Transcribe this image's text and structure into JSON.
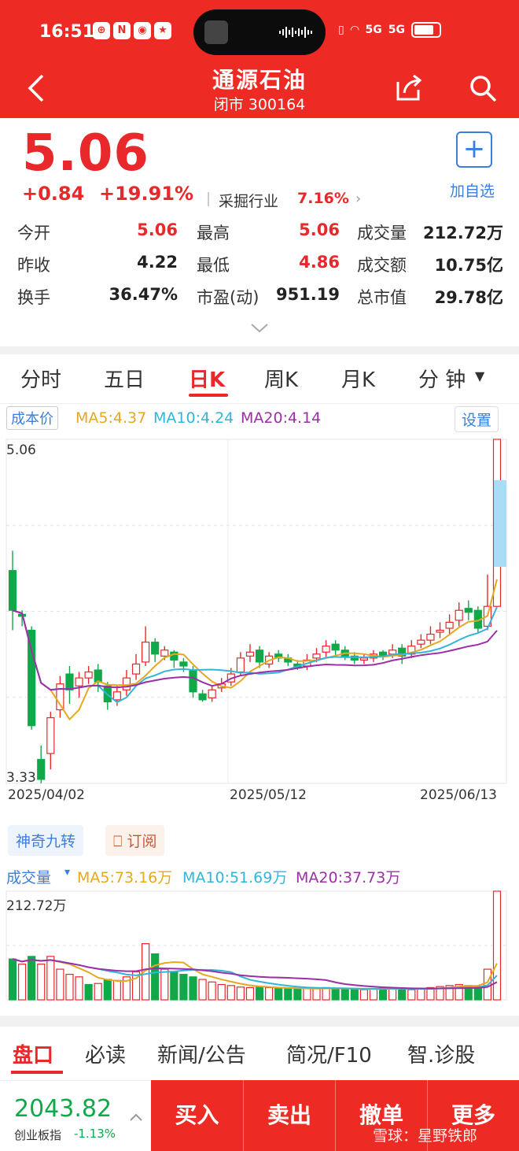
{
  "status": {
    "time": "16:51",
    "network1": "5G",
    "network2": "5G"
  },
  "header": {
    "title": "通源石油",
    "subtitle": "闭市 300164"
  },
  "quote": {
    "price": "5.06",
    "change": "+0.84",
    "change_pct": "+19.91%",
    "sector_label": "采掘行业",
    "sector_pct": "7.16%",
    "add_label": "加自选",
    "rows": [
      [
        {
          "l": "今开",
          "v": "5.06",
          "c": "red"
        },
        {
          "l": "最高",
          "v": "5.06",
          "c": "red"
        },
        {
          "l": "成交量",
          "v": "212.72万",
          "c": "blk"
        }
      ],
      [
        {
          "l": "昨收",
          "v": "4.22",
          "c": "blk"
        },
        {
          "l": "最低",
          "v": "4.86",
          "c": "red"
        },
        {
          "l": "成交额",
          "v": "10.75亿",
          "c": "blk"
        }
      ],
      [
        {
          "l": "换手",
          "v": "36.47%",
          "c": "blk"
        },
        {
          "l": "市盈(动)",
          "v": "951.19",
          "c": "blk"
        },
        {
          "l": "总市值",
          "v": "29.78亿",
          "c": "blk"
        }
      ]
    ]
  },
  "tabs": [
    "分时",
    "五日",
    "日K",
    "周K",
    "月K",
    "分 钟"
  ],
  "kline": {
    "cost_label": "成本价",
    "ma5": "MA5:4.37",
    "ma10": "MA10:4.24",
    "ma20": "MA20:4.14",
    "settings": "设置",
    "high_label": "5.06",
    "low_label": "3.33",
    "dates": [
      "2025/04/02",
      "2025/05/12",
      "2025/06/13"
    ]
  },
  "tools": {
    "nine": "神奇九转",
    "subscribe": "订阅"
  },
  "volume": {
    "label": "成交量",
    "ma5": "MA5:73.16万",
    "ma10": "MA10:51.69万",
    "ma20": "MA20:37.73万",
    "max_label": "212.72万"
  },
  "bottom_tabs": [
    "盘口",
    "必读",
    "新闻/公告",
    "简况/F10",
    "智.诊股"
  ],
  "index": {
    "value": "2043.82",
    "name": "创业板指",
    "pct": "-1.13%"
  },
  "actions": [
    "买入",
    "卖出",
    "撤单",
    "更多"
  ],
  "watermark": "雪球：星野铁郎",
  "colors": {
    "up": "#e8282a",
    "down": "#11a84a",
    "ma5": "#e6a820",
    "ma10": "#33b5d9",
    "ma20": "#9b2fa5",
    "brand": "#ee2a24"
  },
  "chart_data": [
    {
      "type": "candlestick",
      "title": "日K",
      "ylim": [
        3.33,
        5.06
      ],
      "x_ticks": [
        "2025/04/02",
        "2025/05/12",
        "2025/06/13"
      ],
      "candles": [
        [
          4.4,
          4.2,
          4.5,
          4.1
        ],
        [
          4.18,
          4.17,
          4.2,
          4.12
        ],
        [
          4.1,
          3.62,
          4.12,
          3.6
        ],
        [
          3.45,
          3.35,
          3.52,
          3.33
        ],
        [
          3.48,
          3.66,
          3.69,
          3.4
        ],
        [
          3.7,
          3.83,
          3.87,
          3.66
        ],
        [
          3.88,
          3.8,
          3.92,
          3.73
        ],
        [
          3.82,
          3.86,
          3.89,
          3.76
        ],
        [
          3.86,
          3.89,
          3.92,
          3.83
        ],
        [
          3.9,
          3.84,
          3.93,
          3.79
        ],
        [
          3.82,
          3.74,
          3.84,
          3.7
        ],
        [
          3.75,
          3.79,
          3.82,
          3.72
        ],
        [
          3.8,
          3.86,
          3.9,
          3.77
        ],
        [
          3.88,
          3.93,
          3.98,
          3.85
        ],
        [
          3.94,
          4.04,
          4.12,
          3.92
        ],
        [
          4.04,
          3.98,
          4.06,
          3.94
        ],
        [
          3.97,
          4.0,
          4.02,
          3.95
        ],
        [
          3.99,
          3.95,
          4.0,
          3.91
        ],
        [
          3.94,
          3.92,
          3.96,
          3.89
        ],
        [
          3.9,
          3.79,
          3.92,
          3.76
        ],
        [
          3.78,
          3.75,
          3.8,
          3.74
        ],
        [
          3.76,
          3.8,
          3.82,
          3.74
        ],
        [
          3.81,
          3.83,
          3.86,
          3.79
        ],
        [
          3.84,
          3.88,
          3.91,
          3.82
        ],
        [
          3.89,
          3.96,
          3.99,
          3.87
        ],
        [
          3.97,
          3.99,
          4.03,
          3.94
        ],
        [
          4.0,
          3.94,
          4.02,
          3.91
        ],
        [
          3.93,
          3.97,
          3.99,
          3.91
        ],
        [
          3.98,
          3.96,
          4.0,
          3.94
        ],
        [
          3.96,
          3.94,
          3.98,
          3.92
        ],
        [
          3.93,
          3.91,
          3.95,
          3.9
        ],
        [
          3.92,
          3.95,
          3.98,
          3.9
        ],
        [
          3.96,
          3.98,
          4.01,
          3.94
        ],
        [
          3.99,
          4.02,
          4.05,
          3.96
        ],
        [
          4.03,
          4.0,
          4.05,
          3.97
        ],
        [
          4.0,
          3.97,
          4.02,
          3.95
        ],
        [
          3.97,
          3.95,
          3.99,
          3.93
        ],
        [
          3.95,
          3.96,
          3.98,
          3.93
        ],
        [
          3.96,
          3.98,
          4.0,
          3.94
        ],
        [
          3.99,
          3.97,
          4.0,
          3.95
        ],
        [
          3.98,
          4.0,
          4.03,
          3.96
        ],
        [
          4.01,
          3.97,
          4.03,
          3.93
        ],
        [
          3.98,
          4.02,
          4.05,
          3.96
        ],
        [
          4.03,
          4.05,
          4.08,
          4.01
        ],
        [
          4.05,
          4.08,
          4.12,
          4.03
        ],
        [
          4.09,
          4.1,
          4.14,
          4.06
        ],
        [
          4.11,
          4.14,
          4.18,
          4.08
        ],
        [
          4.15,
          4.2,
          4.24,
          4.12
        ],
        [
          4.21,
          4.19,
          4.25,
          4.15
        ],
        [
          4.2,
          4.11,
          4.22,
          4.09
        ],
        [
          4.12,
          4.22,
          4.38,
          4.1
        ],
        [
          4.22,
          5.06,
          5.06,
          4.86
        ]
      ]
    },
    {
      "type": "bar",
      "title": "成交量",
      "ylim": [
        0,
        212.72
      ],
      "unit": "万",
      "values": [
        80,
        70,
        85,
        70,
        85,
        60,
        50,
        45,
        30,
        32,
        40,
        38,
        45,
        55,
        110,
        90,
        60,
        55,
        50,
        45,
        40,
        35,
        30,
        28,
        25,
        24,
        25,
        24,
        22,
        22,
        21,
        22,
        23,
        24,
        22,
        20,
        21,
        20,
        22,
        24,
        22,
        21,
        20,
        22,
        24,
        26,
        28,
        30,
        28,
        26,
        60,
        212.72
      ],
      "up": [
        false,
        true,
        false,
        true,
        true,
        true,
        true,
        true,
        false,
        true,
        false,
        true,
        true,
        true,
        true,
        false,
        true,
        false,
        false,
        false,
        true,
        true,
        true,
        true,
        true,
        true,
        false,
        true,
        false,
        false,
        false,
        true,
        true,
        true,
        false,
        false,
        false,
        true,
        true,
        false,
        true,
        false,
        true,
        true,
        true,
        true,
        true,
        true,
        false,
        false,
        true,
        true
      ]
    }
  ]
}
